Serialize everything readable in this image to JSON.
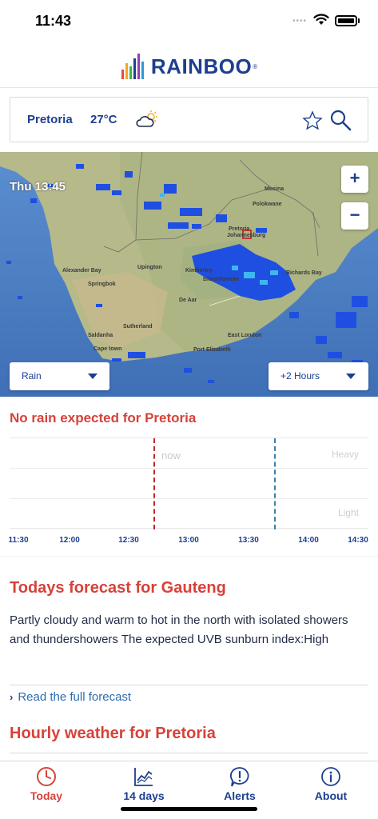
{
  "status_bar": {
    "time": "11:43",
    "dots": "••••"
  },
  "brand": {
    "name": "RAINBOO",
    "mark": "®"
  },
  "location": {
    "city": "Pretoria",
    "temperature": "27°C",
    "weather_icon": "partly-cloudy-icon"
  },
  "map": {
    "time": "Thu 13:45",
    "zoom_in": "+",
    "zoom_out": "−",
    "layer_select": "Rain",
    "time_select": "+2 Hours",
    "places": [
      "Musina",
      "Polokwane",
      "Pretoria",
      "Johannesburg",
      "Richards Bay",
      "Upington",
      "Kimberley",
      "Bloemfontein",
      "Alexander Bay",
      "Springbok",
      "De Aar",
      "Sutherland",
      "East London",
      "Saldanha",
      "Cape town",
      "Port Elizabeth"
    ]
  },
  "rain": {
    "title": "No rain expected for Pretoria",
    "now_label": "now",
    "heavy_label": "Heavy",
    "light_label": "Light",
    "times": [
      "11:30",
      "12:00",
      "12:30",
      "13:00",
      "13:30",
      "14:00",
      "14:30"
    ]
  },
  "forecast": {
    "title": "Todays forecast for Gauteng",
    "text": "Partly cloudy and warm to hot in the north with isolated showers and thundershowers The expected UVB sunburn index:High",
    "read_more": "Read the full forecast"
  },
  "hourly": {
    "title": "Hourly weather for Pretoria"
  },
  "tabs": [
    {
      "label": "Today",
      "icon": "clock-icon",
      "active": true
    },
    {
      "label": "14 days",
      "icon": "chart-icon",
      "active": false
    },
    {
      "label": "Alerts",
      "icon": "alert-icon",
      "active": false
    },
    {
      "label": "About",
      "icon": "info-icon",
      "active": false
    }
  ],
  "colors": {
    "brand_blue": "#1d3f8f",
    "accent_red": "#d6423a",
    "now_line": "#c0272d",
    "forecast_line": "#3a7fa8",
    "radar_blue": "#1f4fe0"
  }
}
